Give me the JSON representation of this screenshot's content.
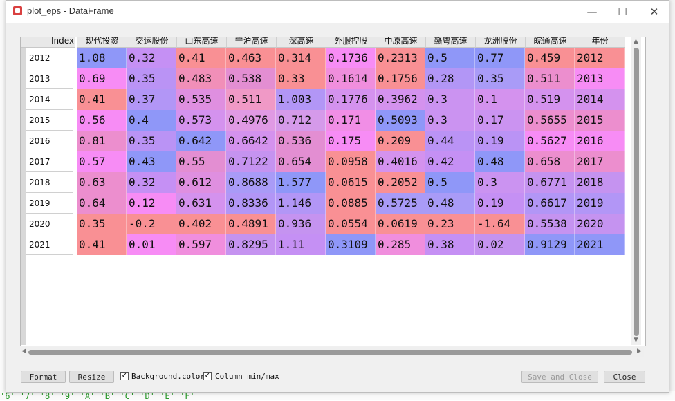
{
  "window": {
    "title": "plot_eps - DataFrame",
    "controls": {
      "minimize": "—",
      "maximize": "☐",
      "close": "✕"
    }
  },
  "table": {
    "index_header": "Index",
    "columns": [
      "现代投资",
      "交运股份",
      "山东高速",
      "宁沪高速",
      "深高速",
      "外服控股",
      "中原高速",
      "赣粤高速",
      "龙洲股份",
      "皖通高速",
      "年份"
    ],
    "index": [
      "2012",
      "2013",
      "2014",
      "2015",
      "2016",
      "2017",
      "2018",
      "2019",
      "2020",
      "2021"
    ],
    "rows": [
      [
        "1.08",
        "0.32",
        "0.41",
        "0.463",
        "0.314",
        "0.1736",
        "0.2313",
        "0.5",
        "0.77",
        "0.459",
        "2012"
      ],
      [
        "0.69",
        "0.35",
        "0.483",
        "0.538",
        "0.33",
        "0.1614",
        "0.1756",
        "0.28",
        "0.35",
        "0.511",
        "2013"
      ],
      [
        "0.41",
        "0.37",
        "0.535",
        "0.511",
        "1.003",
        "0.1776",
        "0.3962",
        "0.3",
        "0.1",
        "0.519",
        "2014"
      ],
      [
        "0.56",
        "0.4",
        "0.573",
        "0.4976",
        "0.712",
        "0.171",
        "0.5093",
        "0.3",
        "0.17",
        "0.5655",
        "2015"
      ],
      [
        "0.81",
        "0.35",
        "0.642",
        "0.6642",
        "0.536",
        "0.175",
        "0.209",
        "0.44",
        "0.19",
        "0.5627",
        "2016"
      ],
      [
        "0.57",
        "0.43",
        "0.55",
        "0.7122",
        "0.654",
        "0.0958",
        "0.4016",
        "0.42",
        "0.48",
        "0.658",
        "2017"
      ],
      [
        "0.63",
        "0.32",
        "0.612",
        "0.8688",
        "1.577",
        "0.0615",
        "0.2052",
        "0.5",
        "0.3",
        "0.6771",
        "2018"
      ],
      [
        "0.64",
        "0.12",
        "0.631",
        "0.8336",
        "1.146",
        "0.0885",
        "0.5725",
        "0.48",
        "0.19",
        "0.6617",
        "2019"
      ],
      [
        "0.35",
        "-0.2",
        "0.402",
        "0.4891",
        "0.936",
        "0.0554",
        "0.0619",
        "0.23",
        "-1.64",
        "0.5538",
        "2020"
      ],
      [
        "0.41",
        "0.01",
        "0.597",
        "0.8295",
        "1.11",
        "0.3109",
        "0.285",
        "0.38",
        "0.02",
        "0.9129",
        "2021"
      ]
    ],
    "colors": [
      [
        "#8f97f8",
        "#c590f4",
        "#f99094",
        "#f99094",
        "#f99094",
        "#f78cf5",
        "#f99094",
        "#8f97f8",
        "#8f97f8",
        "#f99094",
        "#f99094"
      ],
      [
        "#f78cf5",
        "#ba93f5",
        "#f18fb8",
        "#e38ed2",
        "#f99094",
        "#f08edd",
        "#f99094",
        "#b296f6",
        "#a99bf7",
        "#ec8ece",
        "#f78cf5"
      ],
      [
        "#f99094",
        "#b296f6",
        "#df8fe0",
        "#f099c6",
        "#b296f6",
        "#d492ee",
        "#d492ee",
        "#cb93f1",
        "#d492ee",
        "#d492ee",
        "#d492ee"
      ],
      [
        "#f78cf5",
        "#8f97f8",
        "#d492ee",
        "#e09ae4",
        "#d59aea",
        "#f18ee6",
        "#8f97f8",
        "#cb93f1",
        "#cb93f1",
        "#ec8ece",
        "#ec8ece"
      ],
      [
        "#ec8ece",
        "#ba93f5",
        "#8f97f8",
        "#d492ee",
        "#e38ed2",
        "#f78cf5",
        "#f99094",
        "#ba93f5",
        "#ba93f5",
        "#f78cf5",
        "#f78cf5"
      ],
      [
        "#f78cf5",
        "#8f97f8",
        "#e38ed2",
        "#c593f0",
        "#e38ed2",
        "#f99094",
        "#d492ee",
        "#c590f4",
        "#8f97f8",
        "#ec8ece",
        "#ec8ece"
      ],
      [
        "#ec8ece",
        "#c590f4",
        "#df8fe0",
        "#a99bf7",
        "#8f97f8",
        "#f99094",
        "#f99094",
        "#8f97f8",
        "#cb93f1",
        "#c593f0",
        "#c593f0"
      ],
      [
        "#ec8ece",
        "#f78cf5",
        "#d492ee",
        "#b296f6",
        "#b296f6",
        "#f99094",
        "#a99bf7",
        "#a99bf7",
        "#c590f4",
        "#b296f6",
        "#b296f6"
      ],
      [
        "#f99094",
        "#f99094",
        "#f99094",
        "#f99094",
        "#c593f0",
        "#f99094",
        "#f99094",
        "#f99094",
        "#f99094",
        "#c593f0",
        "#c593f0"
      ],
      [
        "#f99094",
        "#f78cf5",
        "#f08edd",
        "#c593f0",
        "#c590f4",
        "#8f97f8",
        "#f08edd",
        "#c590f4",
        "#c593f0",
        "#8f97f8",
        "#8f97f8"
      ]
    ]
  },
  "bottom": {
    "format_label": "Format",
    "resize_label": "Resize",
    "background_color_label": "Background.color",
    "background_color_checked": true,
    "column_minmax_label": "Column min/max",
    "column_minmax_checked": true,
    "save_close_label": "Save and Close",
    "close_label": "Close"
  },
  "background_app": {
    "bottom_text": "'6' '7' '8' '9' 'A' 'B' 'C' 'D' 'E' 'F'"
  }
}
